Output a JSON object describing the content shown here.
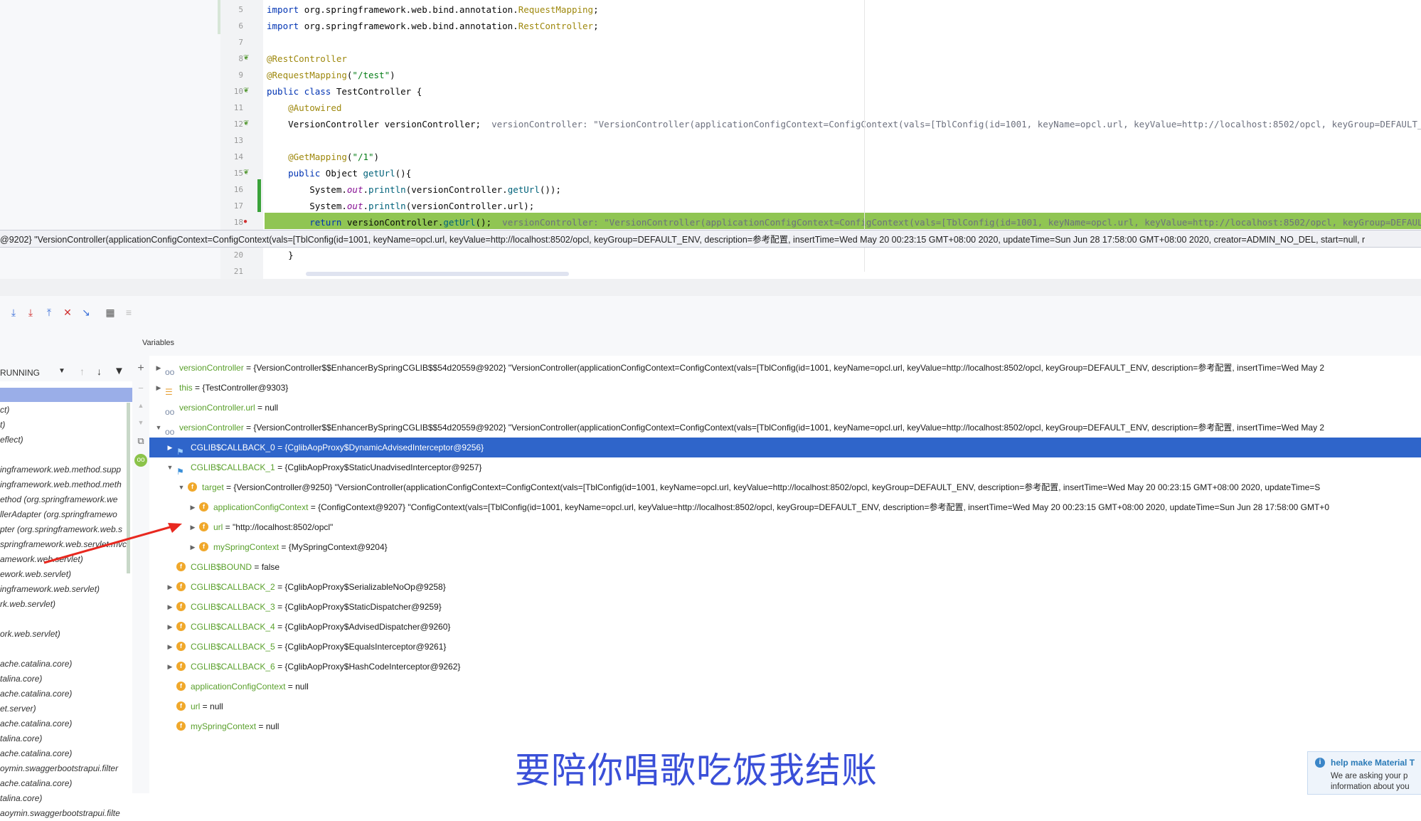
{
  "editor": {
    "lines": [
      {
        "no": "5",
        "parts": [
          [
            "kw",
            "import "
          ],
          [
            "",
            "org.springframework.web.bind.annotation."
          ],
          [
            "ann",
            "RequestMapping"
          ],
          [
            "",
            ";"
          ]
        ]
      },
      {
        "no": "6",
        "parts": [
          [
            "kw",
            "import "
          ],
          [
            "",
            "org.springframework.web.bind.annotation."
          ],
          [
            "ann",
            "RestController"
          ],
          [
            "",
            ";"
          ]
        ]
      },
      {
        "no": "7",
        "parts": []
      },
      {
        "no": "8",
        "parts": [
          [
            "ann",
            "@RestController"
          ]
        ]
      },
      {
        "no": "9",
        "parts": [
          [
            "ann",
            "@RequestMapping"
          ],
          [
            "",
            "("
          ],
          [
            "str",
            "\"/test\""
          ],
          [
            "",
            ")"
          ]
        ]
      },
      {
        "no": "10",
        "parts": [
          [
            "kw",
            "public class "
          ],
          [
            "",
            "TestController {"
          ]
        ]
      },
      {
        "no": "11",
        "parts": [
          [
            "",
            "    "
          ],
          [
            "ann",
            "@Autowired"
          ]
        ]
      },
      {
        "no": "12",
        "parts": [
          [
            "",
            "    VersionController versionController;  "
          ],
          [
            "hint",
            "versionController: \"VersionController(applicationConfigContext=ConfigContext(vals=[TblConfig(id=1001, keyName=opcl.url, keyValue=http://localhost:8502/opcl, keyGroup=DEFAULT_ENV, description=参考配置"
          ]
        ]
      },
      {
        "no": "13",
        "parts": []
      },
      {
        "no": "14",
        "parts": [
          [
            "",
            "    "
          ],
          [
            "ann",
            "@GetMapping"
          ],
          [
            "",
            "("
          ],
          [
            "str",
            "\"/1\""
          ],
          [
            "",
            ")"
          ]
        ]
      },
      {
        "no": "15",
        "parts": [
          [
            "",
            "    "
          ],
          [
            "kw",
            "public "
          ],
          [
            "",
            "Object "
          ],
          [
            "fn",
            "getUrl"
          ],
          [
            "",
            "(){"
          ]
        ]
      },
      {
        "no": "16",
        "parts": [
          [
            "",
            "        System."
          ],
          [
            "ital",
            "out"
          ],
          [
            "",
            "."
          ],
          [
            "fn",
            "println"
          ],
          [
            "",
            "(versionController."
          ],
          [
            "fn",
            "getUrl"
          ],
          [
            "",
            "());"
          ]
        ]
      },
      {
        "no": "17",
        "parts": [
          [
            "",
            "        System."
          ],
          [
            "ital",
            "out"
          ],
          [
            "",
            "."
          ],
          [
            "fn",
            "println"
          ],
          [
            "",
            "(versionController.url);"
          ]
        ]
      },
      {
        "no": "18",
        "parts": [
          [
            "",
            "        "
          ],
          [
            "kw",
            "return "
          ],
          [
            "",
            "versionController."
          ],
          [
            "fn",
            "getUrl"
          ],
          [
            "",
            "();  "
          ],
          [
            "hint",
            "versionController: \"VersionController(applicationConfigContext=ConfigContext(vals=[TblConfig(id=1001, keyName=opcl.url, keyValue=http://localhost:8502/opcl, keyGroup=DEFAULT_ENV, descript"
          ]
        ]
      },
      {
        "no": "20",
        "parts": [
          [
            "",
            "    }"
          ]
        ]
      },
      {
        "no": "21",
        "parts": []
      }
    ],
    "tooltip": "@9202} \"VersionController(applicationConfigContext=ConfigContext(vals=[TblConfig(id=1001, keyName=opcl.url, keyValue=http://localhost:8502/opcl, keyGroup=DEFAULT_ENV, description=参考配置, insertTime=Wed May 20 00:23:15 GMT+08:00 2020, updateTime=Sun Jun 28 17:58:00 GMT+08:00 2020, creator=ADMIN_NO_DEL, start=null, r"
  },
  "debugger": {
    "variables_title": "Variables",
    "thread_status": "RUNNING",
    "frames": [
      "ct)",
      "t)",
      "eflect)",
      "",
      "ingframework.web.method.supp",
      "ingframework.web.method.meth",
      "ethod (org.springframework.we",
      "llerAdapter (org.springframewo",
      "pter (org.springframework.web.s",
      "springframework.web.servlet.mvc",
      "amework.web.servlet)",
      "ework.web.servlet)",
      "ingframework.web.servlet)",
      "rk.web.servlet)",
      "",
      "ork.web.servlet)",
      "",
      "ache.catalina.core)",
      "talina.core)",
      "ache.catalina.core)",
      "et.server)",
      "ache.catalina.core)",
      "talina.core)",
      "ache.catalina.core)",
      "oymin.swaggerbootstrapui.filter",
      "ache.catalina.core)",
      "talina.core)",
      "aoymin.swaggerbootstrapui.filte"
    ],
    "variables": [
      {
        "indent": 0,
        "arrow": "▶",
        "icon": "oo",
        "name": "versionController",
        "value": " = {VersionController$$EnhancerBySpringCGLIB$$54d20559@9202} \"VersionController(applicationConfigContext=ConfigContext(vals=[TblConfig(id=1001, keyName=opcl.url, keyValue=http://localhost:8502/opcl, keyGroup=DEFAULT_ENV, description=参考配置, insertTime=Wed May 2"
      },
      {
        "indent": 0,
        "arrow": "▶",
        "icon": "this",
        "name": "this",
        "value": " = {TestController@9303}"
      },
      {
        "indent": 0,
        "arrow": "",
        "icon": "oo",
        "name": "versionController.url",
        "value": " = null"
      },
      {
        "indent": 0,
        "arrow": "▼",
        "icon": "oo",
        "name": "versionController",
        "value": " = {VersionController$$EnhancerBySpringCGLIB$$54d20559@9202} \"VersionController(applicationConfigContext=ConfigContext(vals=[TblConfig(id=1001, keyName=opcl.url, keyValue=http://localhost:8502/opcl, keyGroup=DEFAULT_ENV, description=参考配置, insertTime=Wed May 2"
      },
      {
        "indent": 1,
        "arrow": "▶",
        "icon": "flag",
        "name": "CGLIB$CALLBACK_0",
        "value": " = {CglibAopProxy$DynamicAdvisedInterceptor@9256}",
        "selected": true
      },
      {
        "indent": 1,
        "arrow": "▼",
        "icon": "flag",
        "name": "CGLIB$CALLBACK_1",
        "value": " = {CglibAopProxy$StaticUnadvisedInterceptor@9257}"
      },
      {
        "indent": 2,
        "arrow": "▼",
        "icon": "f",
        "name": "target",
        "value": " = {VersionController@9250} \"VersionController(applicationConfigContext=ConfigContext(vals=[TblConfig(id=1001, keyName=opcl.url, keyValue=http://localhost:8502/opcl, keyGroup=DEFAULT_ENV, description=参考配置, insertTime=Wed May 20 00:23:15 GMT+08:00 2020, updateTime=S"
      },
      {
        "indent": 3,
        "arrow": "▶",
        "icon": "f",
        "name": "applicationConfigContext",
        "value": " = {ConfigContext@9207} \"ConfigContext(vals=[TblConfig(id=1001, keyName=opcl.url, keyValue=http://localhost:8502/opcl, keyGroup=DEFAULT_ENV, description=参考配置, insertTime=Wed May 20 00:23:15 GMT+08:00 2020, updateTime=Sun Jun 28 17:58:00 GMT+0"
      },
      {
        "indent": 3,
        "arrow": "▶",
        "icon": "f",
        "name": "url",
        "value": " = \"http://localhost:8502/opcl\""
      },
      {
        "indent": 3,
        "arrow": "▶",
        "icon": "f",
        "name": "mySpringContext",
        "value": " = {MySpringContext@9204}"
      },
      {
        "indent": 1,
        "arrow": "",
        "icon": "f",
        "name": "CGLIB$BOUND",
        "value": " = false"
      },
      {
        "indent": 1,
        "arrow": "▶",
        "icon": "f",
        "name": "CGLIB$CALLBACK_2",
        "value": " = {CglibAopProxy$SerializableNoOp@9258}"
      },
      {
        "indent": 1,
        "arrow": "▶",
        "icon": "f",
        "name": "CGLIB$CALLBACK_3",
        "value": " = {CglibAopProxy$StaticDispatcher@9259}"
      },
      {
        "indent": 1,
        "arrow": "▶",
        "icon": "f",
        "name": "CGLIB$CALLBACK_4",
        "value": " = {CglibAopProxy$AdvisedDispatcher@9260}"
      },
      {
        "indent": 1,
        "arrow": "▶",
        "icon": "f",
        "name": "CGLIB$CALLBACK_5",
        "value": " = {CglibAopProxy$EqualsInterceptor@9261}"
      },
      {
        "indent": 1,
        "arrow": "▶",
        "icon": "f",
        "name": "CGLIB$CALLBACK_6",
        "value": " = {CglibAopProxy$HashCodeInterceptor@9262}"
      },
      {
        "indent": 1,
        "arrow": "",
        "icon": "f",
        "name": "applicationConfigContext",
        "value": " = null"
      },
      {
        "indent": 1,
        "arrow": "",
        "icon": "f",
        "name": "url",
        "value": " = null"
      },
      {
        "indent": 1,
        "arrow": "",
        "icon": "f",
        "name": "mySpringContext",
        "value": " = null"
      }
    ]
  },
  "subtitle": "要陪你唱歌吃饭我结账",
  "notification": {
    "title": "help make Material T",
    "body": "We are asking your p information about you"
  },
  "colors": {
    "accent": "#2f65ca",
    "highlight": "#90c553",
    "subtitle": "#3a4fd8"
  }
}
